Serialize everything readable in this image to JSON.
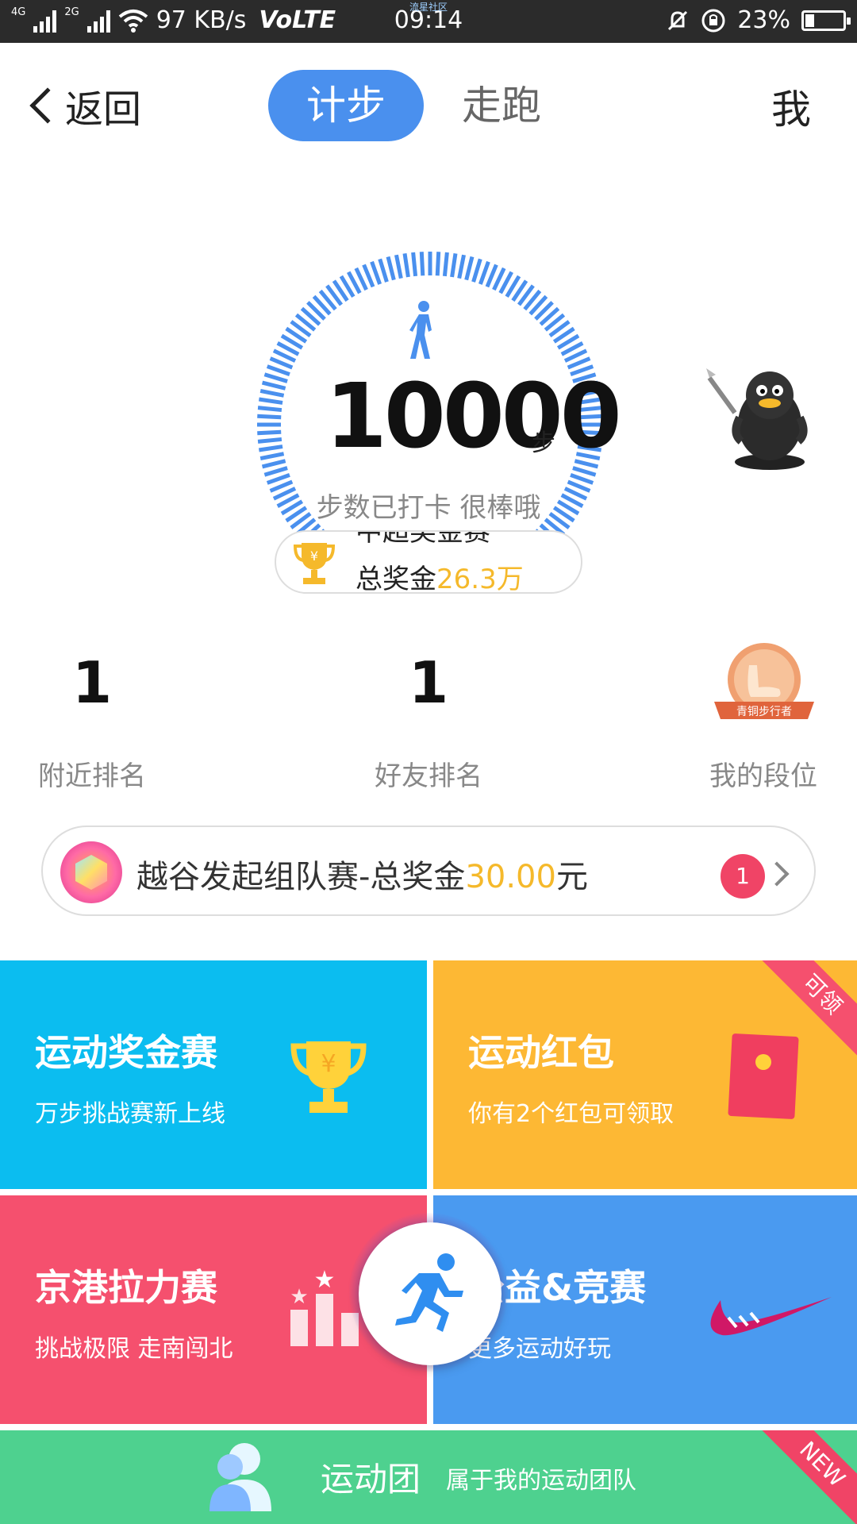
{
  "status_bar": {
    "net1": "4G",
    "net2": "2G",
    "speed": "97 KB/s",
    "volte": "VoLTE",
    "time": "09:14",
    "tiny_caption": "流星社区",
    "battery": "23%",
    "battery_level": 0.23
  },
  "header": {
    "back_label": "返回",
    "tabs": [
      {
        "label": "计步",
        "active": true
      },
      {
        "label": "走跑",
        "active": false
      }
    ],
    "me_label": "我"
  },
  "gauge": {
    "steps": "10000",
    "unit": "步",
    "message": "步数已打卡  很棒哦",
    "progress": 1.0,
    "prize_line1": "中超奖金赛",
    "prize_line2_prefix": "总奖金",
    "prize_line2_amount": "26.3万"
  },
  "ranking": {
    "nearby_value": "1",
    "nearby_label": "附近排名",
    "friends_value": "1",
    "friends_label": "好友排名",
    "level_label": "我的段位",
    "level_badge_text": "青铜步行者"
  },
  "team_banner": {
    "text_prefix": "越谷发起组队赛-总奖金",
    "amount": "30.00",
    "suffix": "元",
    "count": "1"
  },
  "tiles": {
    "prize_race": {
      "title": "运动奖金赛",
      "subtitle": "万步挑战赛新上线"
    },
    "red_packet": {
      "title": "运动红包",
      "subtitle": "你有2个红包可领取",
      "corner": "可领"
    },
    "rally": {
      "title": "京港拉力赛",
      "subtitle": "挑战极限 走南闯北"
    },
    "charity": {
      "title": "公益&竞赛",
      "subtitle": "更多运动好玩"
    },
    "team": {
      "title": "运动团",
      "subtitle": "属于我的运动团队",
      "corner": "NEW"
    }
  },
  "colors": {
    "accent_blue": "#4a90ee",
    "gold": "#f5b92b",
    "tile_cyan": "#0bbdf0",
    "tile_orange": "#fdb834",
    "tile_red": "#f5506e",
    "tile_blue": "#4a9af0",
    "tile_green": "#4ed18f"
  }
}
